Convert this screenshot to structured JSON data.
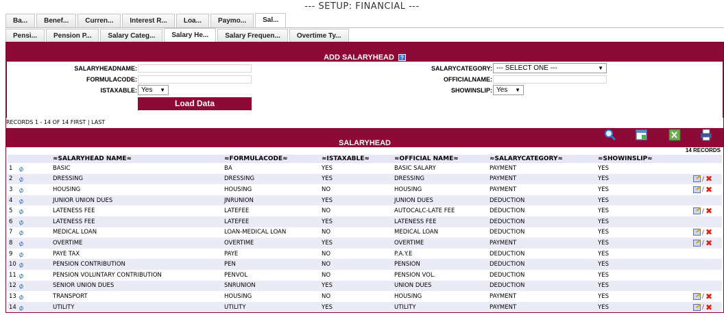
{
  "page": {
    "title": "--- SETUP: FINANCIAL ---"
  },
  "top_tabs": [
    "Ba...",
    "Benef...",
    "Curren...",
    "Interest R...",
    "Loa...",
    "Paymo...",
    "Sal..."
  ],
  "sub_tabs": [
    "Pensi...",
    "Pension P...",
    "Salary Categ...",
    "Salary He...",
    "Salary Frequen...",
    "Overtime Ty..."
  ],
  "form": {
    "header": "ADD SALARYHEAD",
    "salaryheadname_label": "SALARYHEADNAME:",
    "formulacode_label": "FORMULACODE:",
    "istaxable_label": "ISTAXABLE:",
    "istaxable_value": "Yes",
    "salarycategory_label": "SALARYCATEGORY:",
    "salarycategory_value": "--- SELECT ONE ---",
    "officialname_label": "OFFICIALNAME:",
    "showinslip_label": "SHOWINSLIP:",
    "showinslip_value": "Yes",
    "load_button": "Load Data"
  },
  "records_nav": {
    "range": "RECORDS 1 - 14 OF 14",
    "first": "FIRST",
    "divider": "|",
    "last": "LAST"
  },
  "list": {
    "header": "SALARYHEAD",
    "record_count": "14 RECORDS",
    "columns": [
      "≈SALARYHEAD NAME≈",
      "≈FORMULACODE≈",
      "≈ISTAXABLE≈",
      "≈OFFICIAL NAME≈",
      "≈SALARYCATEGORY≈",
      "≈SHOWINSLIP≈"
    ],
    "rows": [
      {
        "n": "1",
        "name": "BASIC",
        "code": "BA",
        "tax": "YES",
        "official": "BASIC SALARY",
        "cat": "PAYMENT",
        "show": "YES",
        "actions": false
      },
      {
        "n": "2",
        "name": "DRESSING",
        "code": "DRESSING",
        "tax": "YES",
        "official": "DRESSING",
        "cat": "PAYMENT",
        "show": "YES",
        "actions": true
      },
      {
        "n": "3",
        "name": "HOUSING",
        "code": "HOUSING",
        "tax": "NO",
        "official": "HOUSING",
        "cat": "PAYMENT",
        "show": "YES",
        "actions": true
      },
      {
        "n": "4",
        "name": "JUNIOR UNION DUES",
        "code": "JNRUNION",
        "tax": "YES",
        "official": "JUNION DUES",
        "cat": "DEDUCTION",
        "show": "YES",
        "actions": false
      },
      {
        "n": "5",
        "name": "LATENESS FEE",
        "code": "LATEFEE",
        "tax": "NO",
        "official": "AUTOCALC-LATE FEE",
        "cat": "DEDUCTION",
        "show": "YES",
        "actions": true
      },
      {
        "n": "6",
        "name": "LATENESS FEE",
        "code": "LATEFEE",
        "tax": "YES",
        "official": "LATENESS FEE",
        "cat": "DEDUCTION",
        "show": "YES",
        "actions": false
      },
      {
        "n": "7",
        "name": "MEDICAL LOAN",
        "code": "LOAN-MEDICAL LOAN",
        "tax": "NO",
        "official": "MEDICAL LOAN",
        "cat": "DEDUCTION",
        "show": "YES",
        "actions": true
      },
      {
        "n": "8",
        "name": "OVERTIME",
        "code": "OVERTIME",
        "tax": "YES",
        "official": "OVERTIME",
        "cat": "PAYMENT",
        "show": "YES",
        "actions": true
      },
      {
        "n": "9",
        "name": "PAYE TAX",
        "code": "PAYE",
        "tax": "NO",
        "official": "P.A.Y.E",
        "cat": "DEDUCTION",
        "show": "YES",
        "actions": false
      },
      {
        "n": "10",
        "name": "PENSION CONTRIBUTION",
        "code": "PEN",
        "tax": "NO",
        "official": "PENSION",
        "cat": "DEDUCTION",
        "show": "YES",
        "actions": false
      },
      {
        "n": "11",
        "name": "PENSION VOLUNTARY CONTRIBUTION",
        "code": "PENVOL",
        "tax": "NO",
        "official": "PENSION VOL.",
        "cat": "DEDUCTION",
        "show": "YES",
        "actions": false
      },
      {
        "n": "12",
        "name": "SENIOR UNION DUES",
        "code": "SNRUNION",
        "tax": "YES",
        "official": "UNION DUES",
        "cat": "DEDUCTION",
        "show": "YES",
        "actions": false
      },
      {
        "n": "13",
        "name": "TRANSPORT",
        "code": "HOUSING",
        "tax": "NO",
        "official": "HOUSING",
        "cat": "PAYMENT",
        "show": "YES",
        "actions": true
      },
      {
        "n": "14",
        "name": "UTILITY",
        "code": "UTILITY",
        "tax": "YES",
        "official": "UTILITY",
        "cat": "PAYMENT",
        "show": "YES",
        "actions": true
      }
    ]
  },
  "icons": {
    "help": "help-icon",
    "search": "search-icon",
    "calendar": "calendar-icon",
    "excel": "excel-icon",
    "print": "print-icon",
    "attach": "attachment-icon",
    "edit": "edit-icon",
    "delete": "delete-icon"
  },
  "colors": {
    "brand": "#8c0a35",
    "row_alt": "#ebebf7",
    "delete": "#e02010",
    "attach": "#2b6cc4"
  }
}
